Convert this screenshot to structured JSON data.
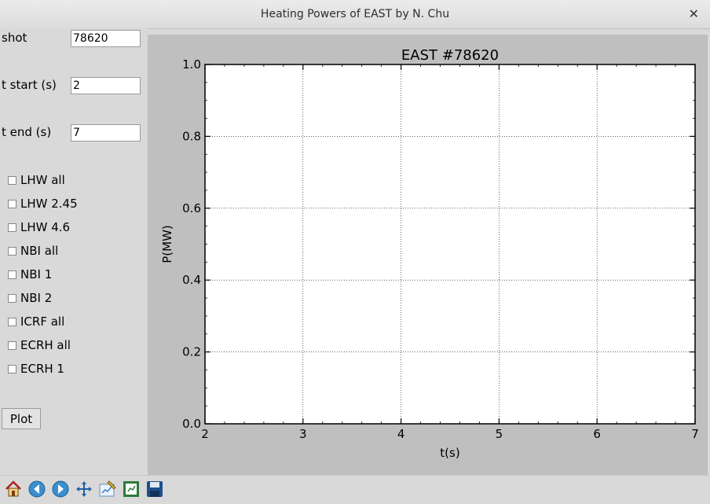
{
  "window": {
    "title": "Heating Powers of EAST by N. Chu"
  },
  "form": {
    "shot_label": "shot",
    "shot_value": "78620",
    "tstart_label": "t start (s)",
    "tstart_value": "2",
    "tend_label": "t end (s)",
    "tend_value": "7"
  },
  "checkboxes": [
    "LHW all",
    "LHW 2.45",
    "LHW 4.6",
    "NBI all",
    "NBI 1",
    "NBI 2",
    "ICRF all",
    "ECRH all",
    "ECRH 1"
  ],
  "plot_button": "Plot",
  "toolbar": {
    "icons": [
      "home-icon",
      "back-arrow-icon",
      "forward-arrow-icon",
      "pan-icon",
      "configure-subplots-icon",
      "zoom-icon",
      "save-icon"
    ]
  },
  "chart_data": {
    "type": "line",
    "title": "EAST #78620",
    "xlabel": "t(s)",
    "ylabel": "P(MW)",
    "xlim": [
      2,
      7
    ],
    "ylim": [
      0.0,
      1.0
    ],
    "xticks": [
      "2",
      "3",
      "4",
      "5",
      "6",
      "7"
    ],
    "yticks": [
      "0.0",
      "0.2",
      "0.4",
      "0.6",
      "0.8",
      "1.0"
    ],
    "grid": true,
    "series": []
  }
}
